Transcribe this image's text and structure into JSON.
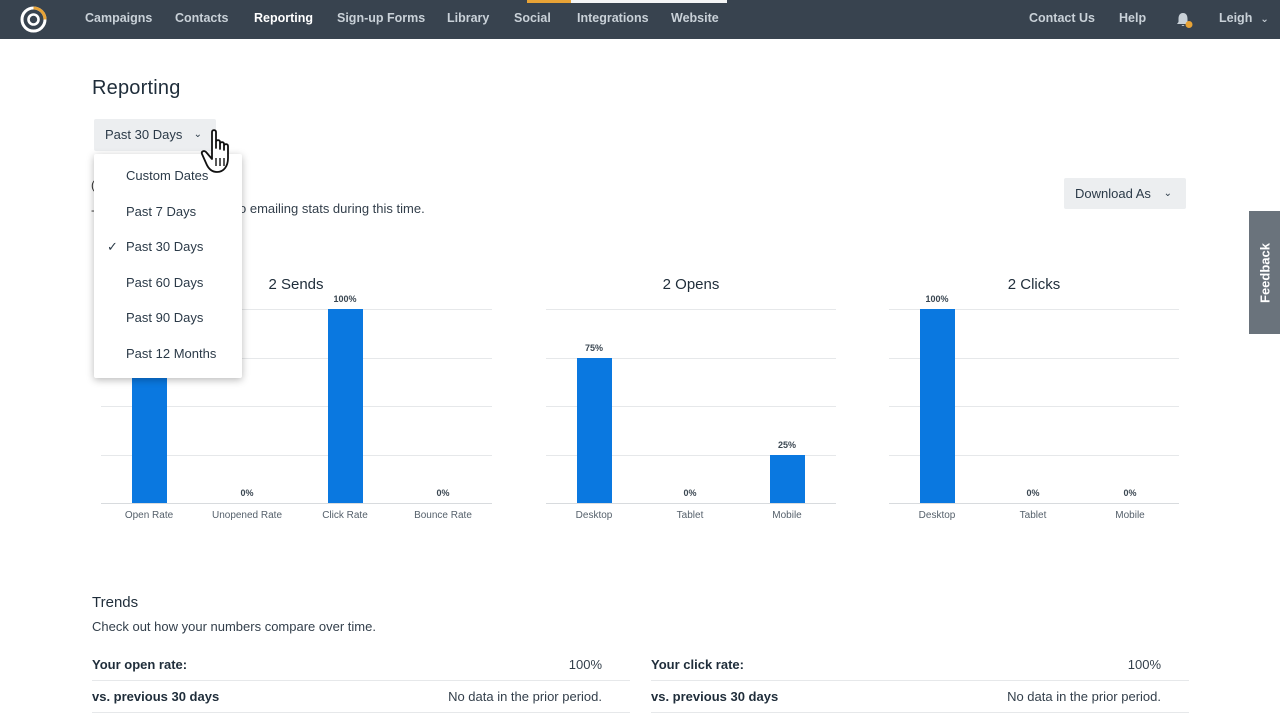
{
  "nav": {
    "items": [
      "Campaigns",
      "Contacts",
      "Reporting",
      "Sign-up Forms",
      "Library",
      "Social",
      "Integrations",
      "Website"
    ],
    "right": [
      "Contact Us",
      "Help"
    ],
    "user": "Leigh",
    "accent_color": "#e8a336"
  },
  "page": {
    "title": "Reporting",
    "period_selected": "Past 30 Days",
    "period_options": [
      "Custom Dates",
      "Past 7 Days",
      "Past 30 Days",
      "Past 60 Days",
      "Past 90 Days",
      "Past 12 Months"
    ],
    "period_checked_index": 2,
    "hint_text": "o emailing stats during this time.",
    "download_label": "Download As"
  },
  "chart_data": [
    {
      "type": "bar",
      "title": "2 Sends",
      "categories": [
        "Open Rate",
        "Unopened Rate",
        "Click Rate",
        "Bounce Rate"
      ],
      "values": [
        100,
        0,
        100,
        0
      ],
      "data_labels": [
        "",
        "0%",
        "100%",
        "0%"
      ],
      "ylim": [
        0,
        100
      ],
      "grid": true,
      "color": "#0a78e0"
    },
    {
      "type": "bar",
      "title": "2 Opens",
      "categories": [
        "Desktop",
        "Tablet",
        "Mobile"
      ],
      "values": [
        75,
        0,
        25
      ],
      "data_labels": [
        "75%",
        "0%",
        "25%"
      ],
      "ylim": [
        0,
        100
      ],
      "grid": true,
      "color": "#0a78e0"
    },
    {
      "type": "bar",
      "title": "2 Clicks",
      "categories": [
        "Desktop",
        "Tablet",
        "Mobile"
      ],
      "values": [
        100,
        0,
        0
      ],
      "data_labels": [
        "100%",
        "0%",
        "0%"
      ],
      "ylim": [
        0,
        100
      ],
      "grid": true,
      "color": "#0a78e0"
    }
  ],
  "feedback": "Feedback",
  "trends": {
    "title": "Trends",
    "subtitle": "Check out how your numbers compare over time.",
    "left": [
      {
        "label": "Your open rate:",
        "value": "100%"
      },
      {
        "label": "vs. previous 30 days",
        "value": "No data in the prior period."
      }
    ],
    "right": [
      {
        "label": "Your click rate:",
        "value": "100%"
      },
      {
        "label": "vs. previous 30 days",
        "value": "No data in the prior period."
      }
    ]
  }
}
